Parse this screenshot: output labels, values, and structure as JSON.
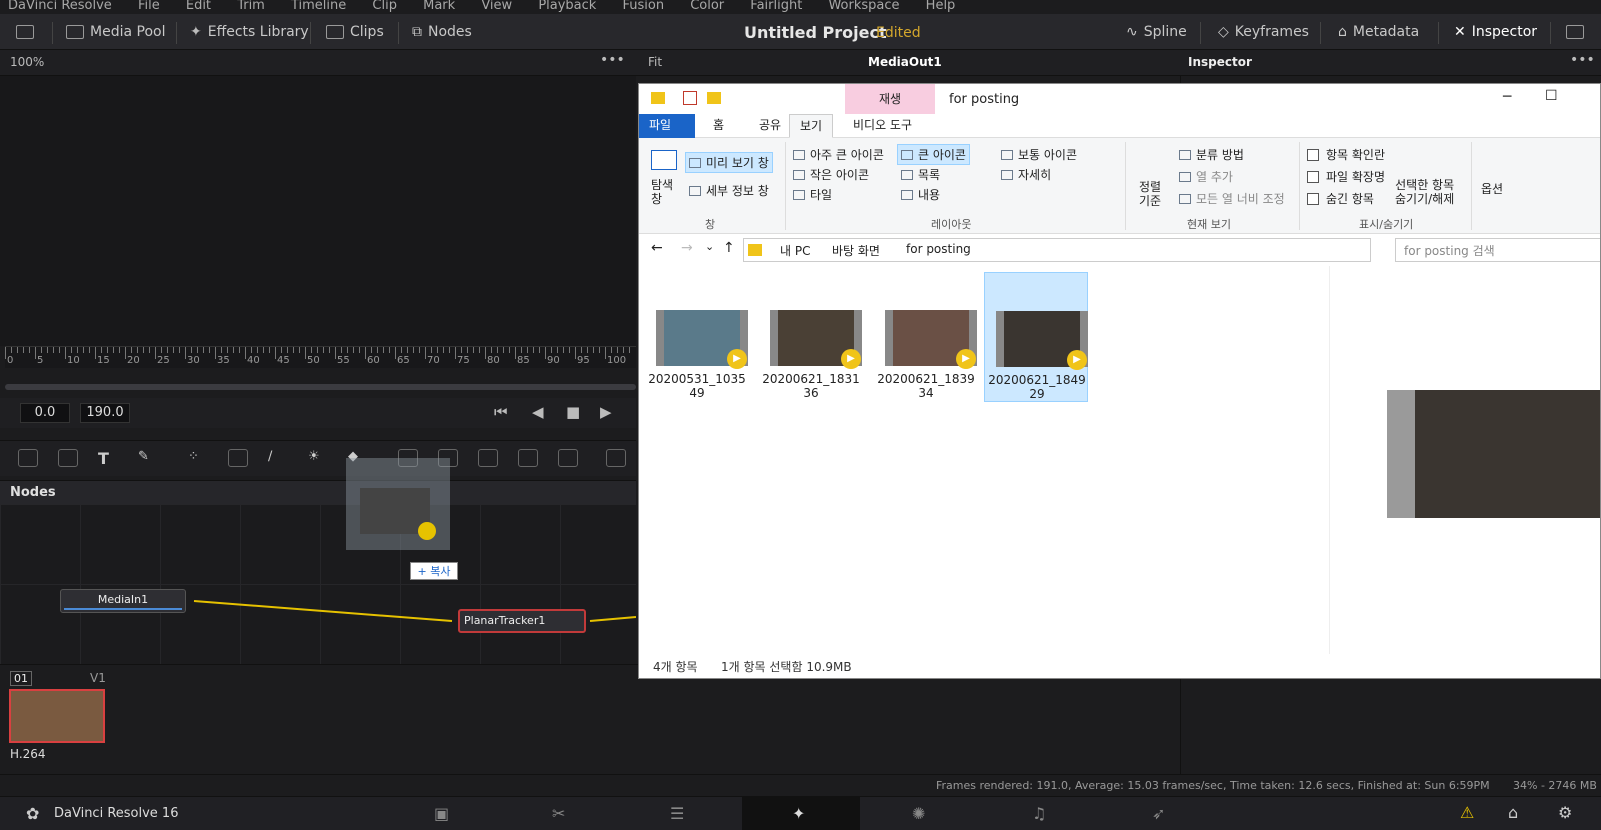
{
  "menubar": {
    "app": "DaVinci Resolve",
    "items": [
      "File",
      "Edit",
      "Trim",
      "Timeline",
      "Clip",
      "Mark",
      "View",
      "Playback",
      "Fusion",
      "Color",
      "Fairlight",
      "Workspace",
      "Help"
    ]
  },
  "toolbar": {
    "media_pool": "Media Pool",
    "effects_library": "Effects Library",
    "clips": "Clips",
    "nodes": "Nodes",
    "project_title": "Untitled Project",
    "edited": "Edited",
    "spline": "Spline",
    "keyframes": "Keyframes",
    "metadata": "Metadata",
    "inspector": "Inspector"
  },
  "subbar": {
    "zoom": "100%",
    "fit": "Fit",
    "viewer_name": "MediaOut1",
    "inspector_title": "Inspector"
  },
  "ruler": {
    "labels": [
      "0",
      "5",
      "10",
      "15",
      "20",
      "25",
      "30",
      "35",
      "40",
      "45",
      "50",
      "55",
      "60",
      "65",
      "70",
      "75",
      "80",
      "85",
      "90",
      "95",
      "100"
    ]
  },
  "transport": {
    "start": "0.0",
    "end": "190.0"
  },
  "nodes": {
    "header": "Nodes",
    "media_in": "MediaIn1",
    "planar_tracker": "PlanarTracker1",
    "copy_label": "+ 복사"
  },
  "clipbar": {
    "track_num": "01",
    "track_v": "V1",
    "codec": "H.264"
  },
  "status": {
    "render_info": "Frames rendered: 191.0,  Average: 15.03 frames/sec,  Time taken: 12.6 secs,  Finished at: Sun 6:59PM",
    "memory": "34% - 2746 MB"
  },
  "pagebar": {
    "app_name": "DaVinci Resolve 16"
  },
  "explorer": {
    "title": "for posting",
    "context_tab": "재생",
    "tabs": [
      "파일",
      "홈",
      "공유",
      "보기",
      "비디오 도구"
    ],
    "ribbon": {
      "nav_pane": "탐색\n창",
      "preview_pane": "미리 보기 창",
      "details_pane": "세부 정보 창",
      "group_pane": "창",
      "layout_items": [
        "아주 큰 아이콘",
        "큰 아이콘",
        "보통 아이콘",
        "작은 아이콘",
        "목록",
        "자세히",
        "타일",
        "내용"
      ],
      "group_layout": "레이아웃",
      "sort_by": "정렬\n기준",
      "group_by": "분류 방법",
      "add_columns": "열 추가",
      "fit_columns": "모든 열 너비 조정",
      "group_current": "현재 보기",
      "item_checkboxes": "항목 확인란",
      "file_extensions": "파일 확장명",
      "hidden_items": "숨긴 항목",
      "hide_selected": "선택한 항목\n숨기기/해제",
      "group_showhide": "표시/숨기기",
      "options": "옵션"
    },
    "breadcrumb": [
      "내 PC",
      "바탕 화면",
      "for posting"
    ],
    "search_placeholder": "for posting 검색",
    "files": [
      {
        "name": "20200531_1035\n49"
      },
      {
        "name": "20200621_1831\n36"
      },
      {
        "name": "20200621_1839\n34"
      },
      {
        "name": "20200621_1849\n29"
      }
    ],
    "status_count": "4개 항목",
    "status_selected": "1개 항목 선택함 10.9MB"
  },
  "colors": {
    "accent_yellow": "#d4a72c",
    "selection_blue": "#cce8ff",
    "node_link": "#e6c200",
    "ribbon_file_tab": "#1a64c8"
  }
}
